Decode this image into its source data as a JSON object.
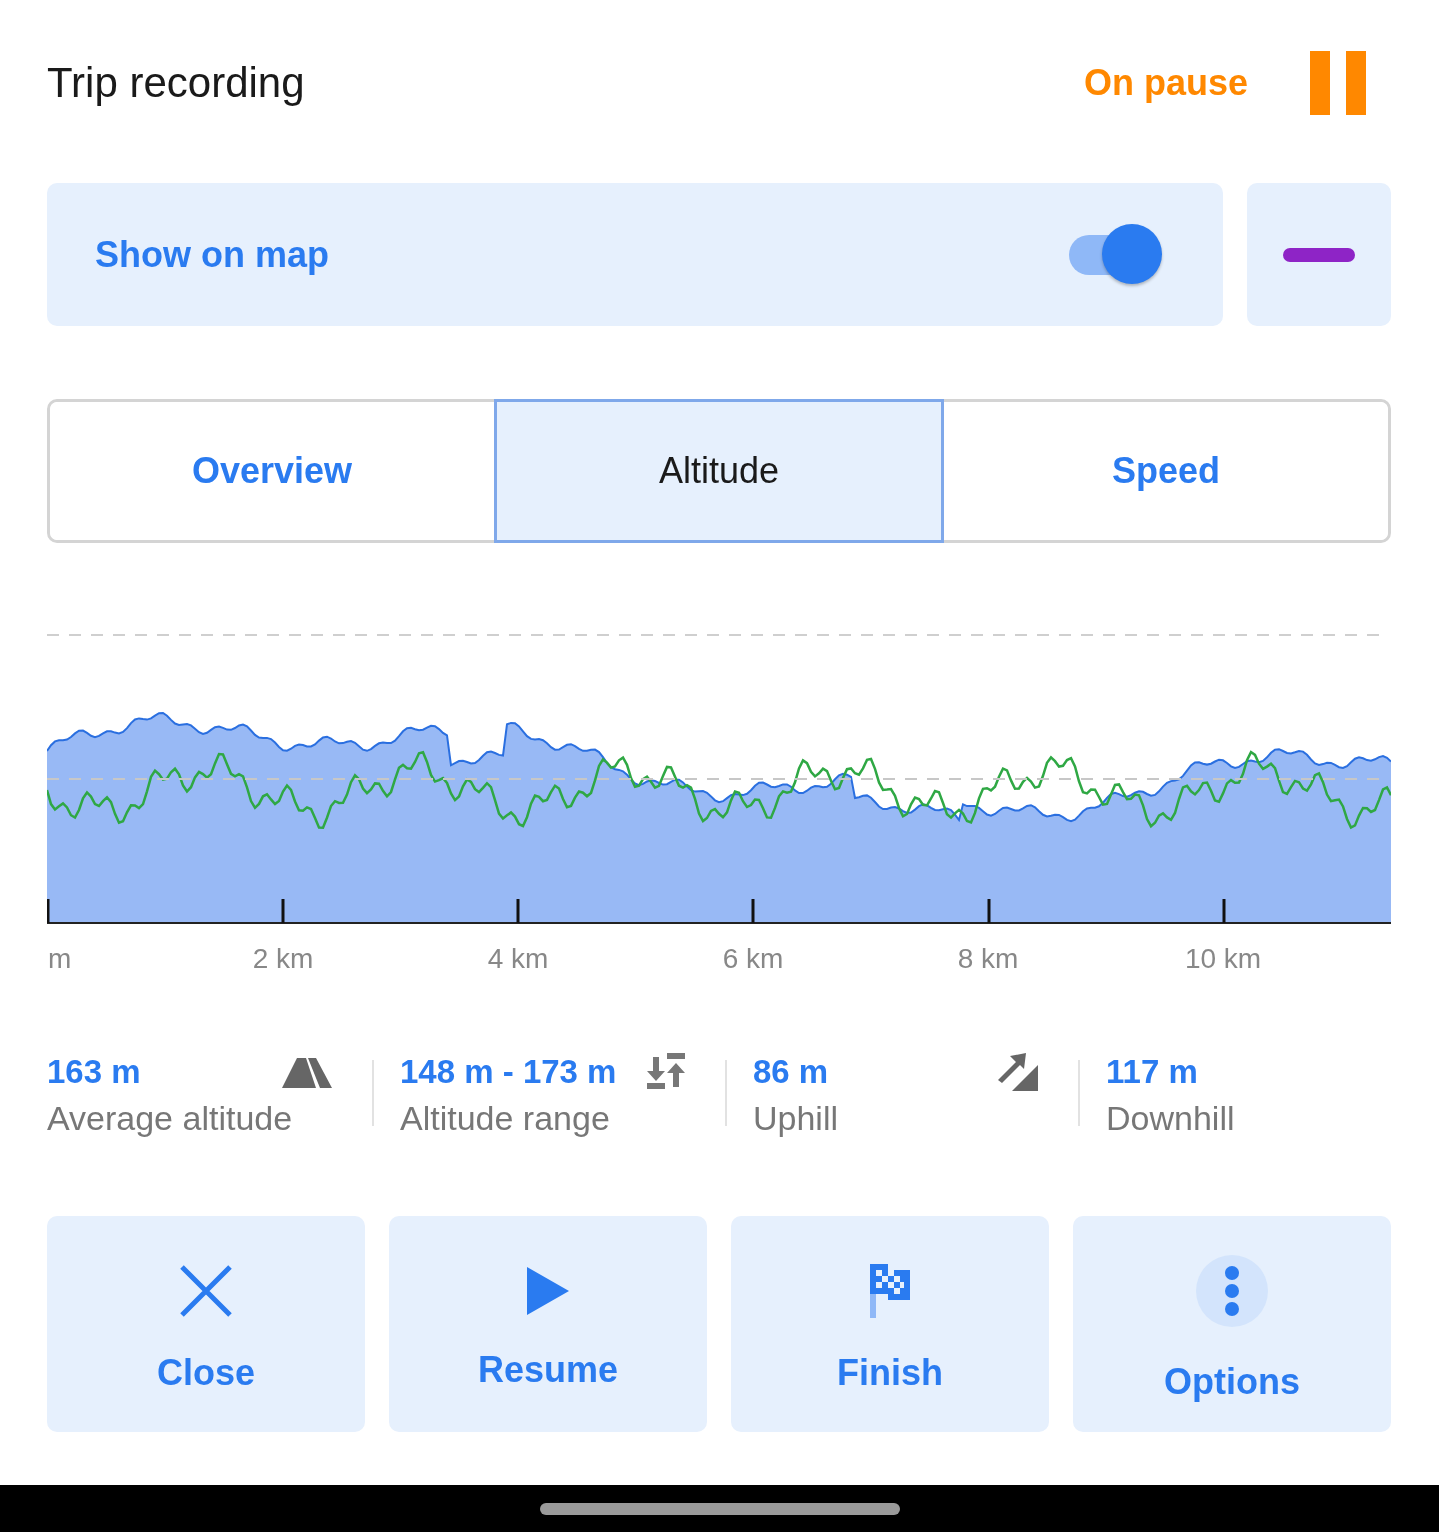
{
  "header": {
    "title": "Trip recording",
    "status": "On pause"
  },
  "map_card": {
    "label": "Show on map",
    "on": true
  },
  "tabs": [
    {
      "label": "Overview",
      "selected": false
    },
    {
      "label": "Altitude",
      "selected": true
    },
    {
      "label": "Speed",
      "selected": false
    }
  ],
  "chart": {
    "x_labels": [
      "m",
      "2 km",
      "4 km",
      "6 km",
      "8 km",
      "10 km"
    ]
  },
  "stats": [
    {
      "value": "163 m",
      "label": "Average altitude"
    },
    {
      "value": "148 m - 173 m",
      "label": "Altitude range"
    },
    {
      "value": "86 m",
      "label": "Uphill"
    },
    {
      "value": "117 m",
      "label": "Downhill"
    }
  ],
  "actions": [
    {
      "label": "Close"
    },
    {
      "label": "Resume"
    },
    {
      "label": "Finish"
    },
    {
      "label": "Options"
    }
  ]
}
